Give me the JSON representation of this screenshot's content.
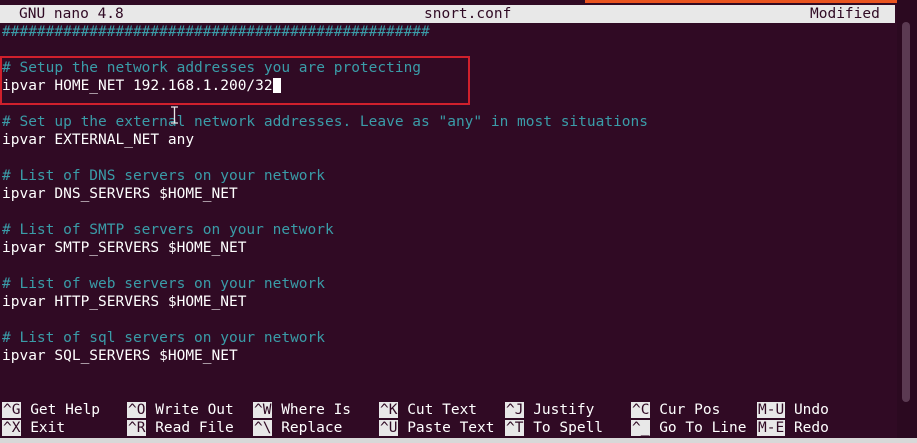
{
  "titlebar": {
    "app": "GNU nano 4.8",
    "filename": "snort.conf",
    "status": "Modified"
  },
  "editor": {
    "separator": "#################################################",
    "lines": [
      {
        "type": "comment",
        "text": "# Setup the network addresses you are protecting"
      },
      {
        "type": "code",
        "text": "ipvar HOME_NET 192.168.1.200/32"
      },
      {
        "type": "blank",
        "text": ""
      },
      {
        "type": "comment",
        "text": "# Set up the external network addresses. Leave as \"any\" in most situations"
      },
      {
        "type": "code",
        "text": "ipvar EXTERNAL_NET any"
      },
      {
        "type": "blank",
        "text": ""
      },
      {
        "type": "comment",
        "text": "# List of DNS servers on your network"
      },
      {
        "type": "code",
        "text": "ipvar DNS_SERVERS $HOME_NET"
      },
      {
        "type": "blank",
        "text": ""
      },
      {
        "type": "comment",
        "text": "# List of SMTP servers on your network"
      },
      {
        "type": "code",
        "text": "ipvar SMTP_SERVERS $HOME_NET"
      },
      {
        "type": "blank",
        "text": ""
      },
      {
        "type": "comment",
        "text": "# List of web servers on your network"
      },
      {
        "type": "code",
        "text": "ipvar HTTP_SERVERS $HOME_NET"
      },
      {
        "type": "blank",
        "text": ""
      },
      {
        "type": "comment",
        "text": "# List of sql servers on your network"
      },
      {
        "type": "code",
        "text": "ipvar SQL_SERVERS $HOME_NET"
      }
    ]
  },
  "shortcuts": {
    "row1": [
      {
        "key": "^G",
        "label": "Get Help"
      },
      {
        "key": "^O",
        "label": "Write Out"
      },
      {
        "key": "^W",
        "label": "Where Is"
      },
      {
        "key": "^K",
        "label": "Cut Text"
      },
      {
        "key": "^J",
        "label": "Justify"
      },
      {
        "key": "^C",
        "label": "Cur Pos"
      },
      {
        "key": "M-U",
        "label": "Undo"
      }
    ],
    "row2": [
      {
        "key": "^X",
        "label": "Exit"
      },
      {
        "key": "^R",
        "label": "Read File"
      },
      {
        "key": "^\\",
        "label": "Replace"
      },
      {
        "key": "^U",
        "label": "Paste Text"
      },
      {
        "key": "^T",
        "label": "To Spell"
      },
      {
        "key": "^_",
        "label": "Go To Line"
      },
      {
        "key": "M-E",
        "label": "Redo"
      }
    ]
  },
  "colors": {
    "background": "#300a24",
    "comment": "#3a9ca8",
    "highlight_border": "#d0202c",
    "accent": "#e95420"
  }
}
